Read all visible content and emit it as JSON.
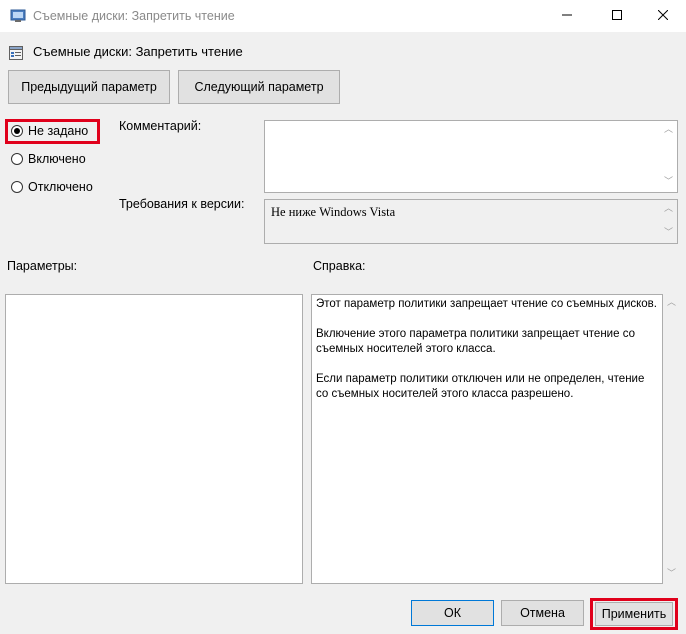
{
  "window": {
    "title": "Съемные диски: Запретить чтение",
    "minimize_icon": "minimize-icon",
    "maximize_icon": "maximize-icon",
    "close_icon": "close-icon"
  },
  "header": {
    "title": "Съемные диски: Запретить чтение",
    "icon": "policy-setting-icon"
  },
  "nav": {
    "prev_label": "Предыдущий параметр",
    "next_label": "Следующий параметр"
  },
  "state": {
    "options": [
      {
        "label": "Не задано",
        "checked": true
      },
      {
        "label": "Включено",
        "checked": false
      },
      {
        "label": "Отключено",
        "checked": false
      }
    ]
  },
  "comment": {
    "label": "Комментарий:",
    "value": ""
  },
  "version": {
    "label": "Требования к версии:",
    "value": "Не ниже Windows Vista"
  },
  "params": {
    "label": "Параметры:"
  },
  "help": {
    "label": "Справка:",
    "paragraphs": [
      "Этот параметр политики запрещает чтение со съемных дисков.",
      "Включение этого параметра политики запрещает чтение со съемных носителей этого класса.",
      "Если параметр политики отключен или не определен, чтение со съемных носителей этого класса разрешено."
    ]
  },
  "footer": {
    "ok_label": "ОК",
    "cancel_label": "Отмена",
    "apply_label": "Применить"
  },
  "colors": {
    "highlight": "#e0001b",
    "ok_border": "#0078d7"
  }
}
